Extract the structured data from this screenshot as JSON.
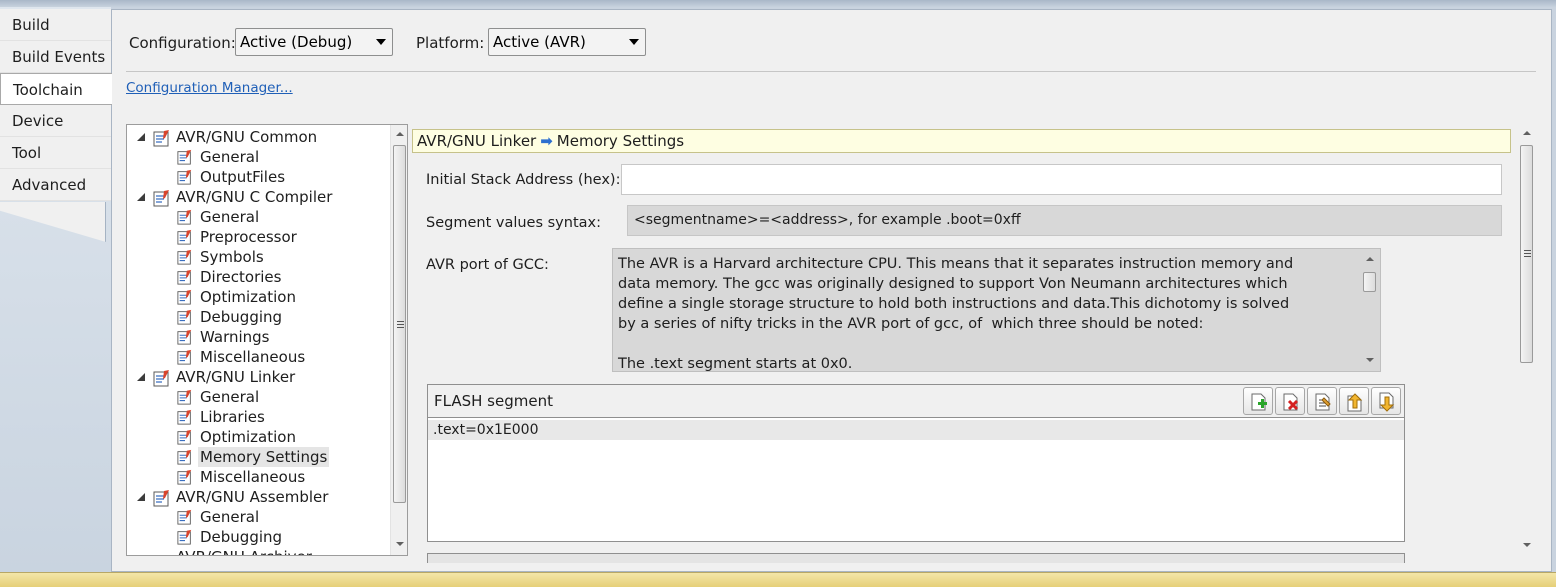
{
  "side_tabs": [
    {
      "label": "Build"
    },
    {
      "label": "Build Events"
    },
    {
      "label": "Toolchain",
      "active": true
    },
    {
      "label": "Device"
    },
    {
      "label": "Tool"
    },
    {
      "label": "Advanced"
    }
  ],
  "config": {
    "configuration_label": "Configuration:",
    "configuration_value": "Active (Debug)",
    "platform_label": "Platform:",
    "platform_value": "Active (AVR)",
    "manager_link": "Configuration Manager..."
  },
  "tree": {
    "groups": [
      {
        "label": "AVR/GNU Common",
        "children": [
          "General",
          "OutputFiles"
        ]
      },
      {
        "label": "AVR/GNU C Compiler",
        "children": [
          "General",
          "Preprocessor",
          "Symbols",
          "Directories",
          "Optimization",
          "Debugging",
          "Warnings",
          "Miscellaneous"
        ]
      },
      {
        "label": "AVR/GNU Linker",
        "children": [
          "General",
          "Libraries",
          "Optimization",
          "Memory Settings",
          "Miscellaneous"
        ]
      },
      {
        "label": "AVR/GNU Assembler",
        "children": [
          "General",
          "Debugging"
        ]
      }
    ],
    "selected": "Memory Settings",
    "cut_off_label": "AVR/GNU Archiver"
  },
  "properties": {
    "header_section": "AVR/GNU Linker",
    "header_page": "Memory Settings",
    "stack_label": "Initial Stack Address (hex):",
    "stack_value": "",
    "syntax_label": "Segment values syntax:",
    "syntax_value": "<segmentname>=<address>, for example  .boot=0xff",
    "avr_port_label": "AVR port of GCC:",
    "avr_port_text": "The AVR is a Harvard architecture CPU. This means that it separates instruction memory and\ndata memory. The gcc was originally designed to support Von Neumann architectures which\ndefine a single storage structure to hold both instructions and data.This dichotomy is solved\nby a series of nifty tricks in the AVR port of gcc, of  which three should be noted:\n\nThe .text segment starts at 0x0.",
    "flash_title": "FLASH segment",
    "flash_rows": [
      ".text=0x1E000"
    ],
    "toolbar_icons": [
      "add-item-icon",
      "delete-item-icon",
      "edit-item-icon",
      "move-up-icon",
      "move-down-icon"
    ]
  },
  "colors": {
    "accent_link": "#1f5fb7",
    "header_bg": "#fefee2",
    "readonly_bg": "#d8d8d8"
  }
}
